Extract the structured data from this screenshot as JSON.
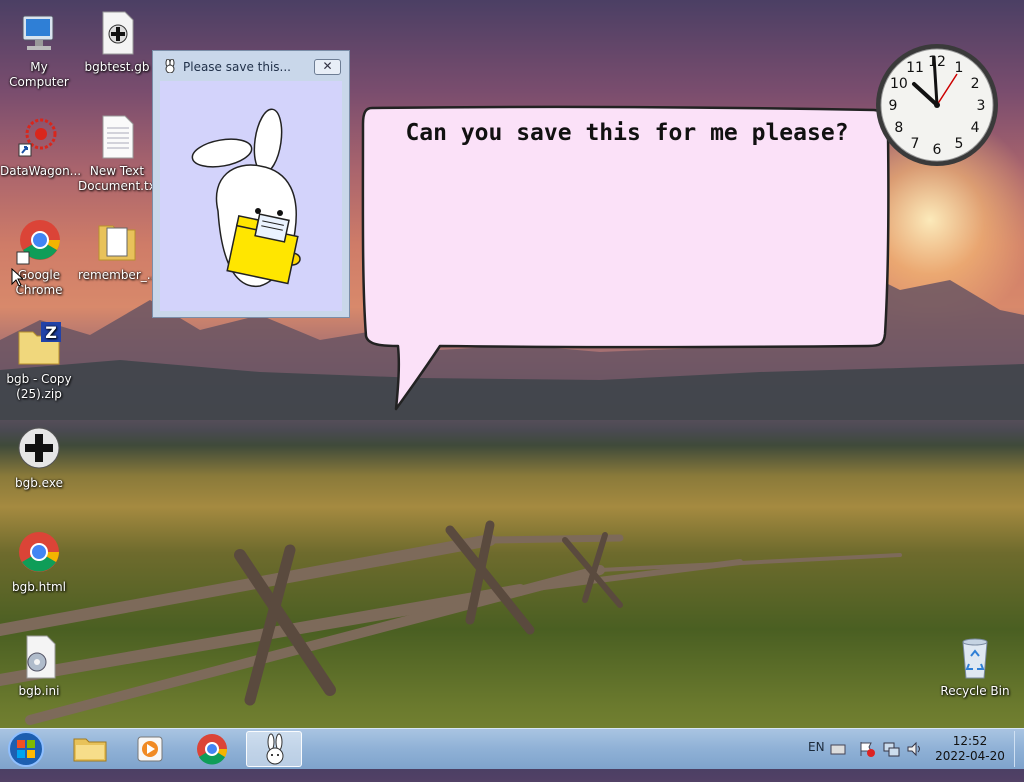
{
  "desktop": {
    "icons": [
      {
        "label": "My Computer",
        "icon": "computer-icon"
      },
      {
        "label": "bgbtest.gb",
        "icon": "gamepad-file-icon"
      },
      {
        "label": "DataWagon...",
        "icon": "datawagon-icon"
      },
      {
        "label": "New Text Document.txt",
        "icon": "text-file-icon"
      },
      {
        "label": "Google Chrome",
        "icon": "chrome-icon"
      },
      {
        "label": "remember_...",
        "icon": "folder-icon"
      },
      {
        "label": "bgb - Copy (25).zip",
        "icon": "zip-folder-icon"
      },
      {
        "label": "bgb.exe",
        "icon": "gamepad-app-icon"
      },
      {
        "label": "bgb.html",
        "icon": "chrome-icon"
      },
      {
        "label": "bgb.ini",
        "icon": "settings-file-icon"
      },
      {
        "label": "Recycle Bin",
        "icon": "recycle-bin-icon"
      }
    ]
  },
  "window": {
    "title": "Please save this...",
    "close_label": "✕"
  },
  "bubble": {
    "text": "Can you save this for me please?"
  },
  "clock_gadget": {
    "numbers": [
      "12",
      "1",
      "2",
      "3",
      "4",
      "5",
      "6",
      "7",
      "8",
      "9",
      "10",
      "11"
    ],
    "time": "12:52"
  },
  "taskbar": {
    "items": [
      "start-button",
      "explorer-icon",
      "media-player-icon",
      "chrome-icon",
      "bunny-app-icon"
    ],
    "language": "EN",
    "time": "12:52",
    "date": "2022-04-20"
  }
}
